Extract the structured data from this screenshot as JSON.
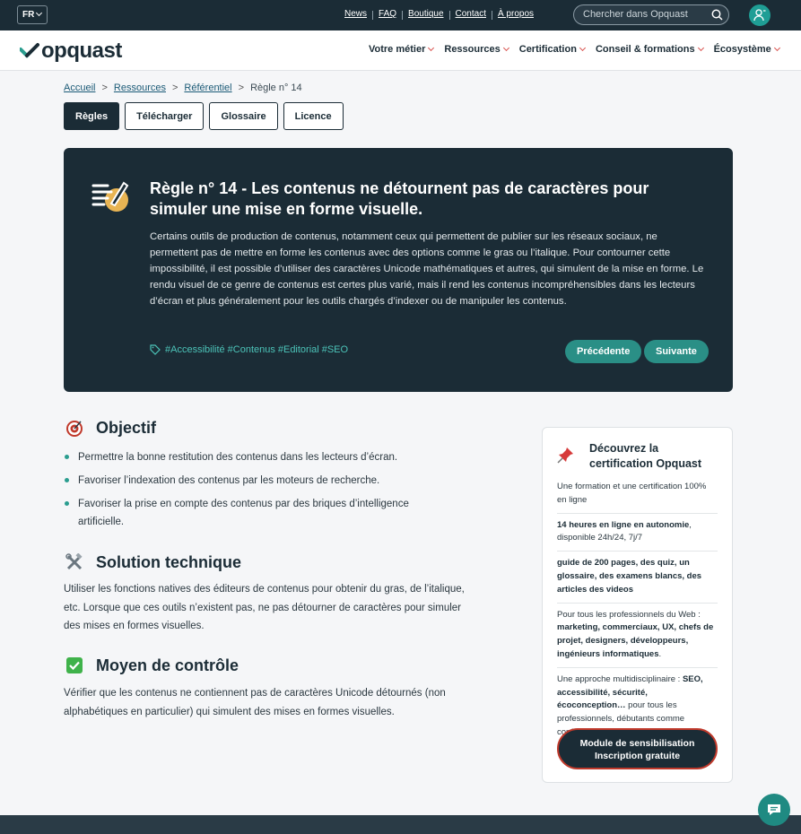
{
  "topbar": {
    "lang": "FR",
    "links": [
      "News",
      "FAQ",
      "Boutique",
      "Contact",
      "À propos"
    ],
    "search_placeholder": "Chercher dans Opquast"
  },
  "nav": {
    "logo": "opquast",
    "menu": [
      "Votre métier",
      "Ressources",
      "Certification",
      "Conseil & formations",
      "Écosystème"
    ]
  },
  "breadcrumb": {
    "items": [
      "Accueil",
      "Ressources",
      "Référentiel"
    ],
    "current": "Règle n° 14"
  },
  "tabs": [
    "Règles",
    "Télécharger",
    "Glossaire",
    "Licence"
  ],
  "hero": {
    "title": "Règle n° 14 - Les contenus ne détournent pas de caractères pour simuler une mise en forme visuelle.",
    "body": "Certains outils de production de contenus, notamment ceux qui permettent de publier sur les réseaux sociaux, ne permettent pas de mettre en forme les contenus avec des options comme le gras ou l’italique. Pour contourner cette impossibilité, il est possible d’utiliser des caractères Unicode mathématiques et autres, qui simulent de la mise en forme. Le rendu visuel de ce genre de contenus est certes plus varié, mais il rend les contenus incompréhensibles dans les lecteurs d’écran et plus généralement pour les outils chargés d’indexer ou de manipuler les contenus.",
    "tags": [
      "#Accessibilité",
      "#Contenus",
      "#Editorial",
      "#SEO"
    ],
    "prev": "Précédente",
    "next": "Suivante"
  },
  "objectif": {
    "title": "Objectif",
    "items": [
      "Permettre la bonne restitution des contenus dans les lecteurs d’écran.",
      "Favoriser l’indexation des contenus par les moteurs de recherche.",
      "Favoriser la prise en compte des contenus par des briques d’intelligence artificielle."
    ]
  },
  "solution": {
    "title": "Solution technique",
    "text": "Utiliser les fonctions natives des éditeurs de contenus pour obtenir du gras, de l’italique, etc. Lorsque que ces outils n’existent pas, ne pas détourner de caractères pour simuler des mises en formes visuelles."
  },
  "controle": {
    "title": "Moyen de contrôle",
    "text": "Vérifier que les contenus ne contiennent pas de caractères Unicode détournés (non alphabétiques en particulier) qui simulent des mises en formes visuelles."
  },
  "card": {
    "title": "Découvrez la certification Opquast",
    "item1": "Une formation et une certification 100% en ligne",
    "item2_bold": "14 heures en ligne en autonomie",
    "item2_rest": ", disponible 24h/24, 7j/7",
    "item3_bold": "guide de 200 pages, des quiz, un glossaire, des examens blancs, des articles des videos",
    "item4_pre": "Pour tous les professionnels du Web : ",
    "item4_bold": "marketing, commerciaux, UX, chefs de projet, designers, développeurs, ingénieurs informatiques",
    "item4_post": ".",
    "item5_pre": "Une approche multidisciplinaire : ",
    "item5_bold": "SEO, accessibilité, sécurité, écoconception…",
    "item5_post": " pour tous les professionnels, débutants comme confirmés.",
    "button_line1": "Module de sensibilisation",
    "button_line2": "Inscription gratuite"
  }
}
